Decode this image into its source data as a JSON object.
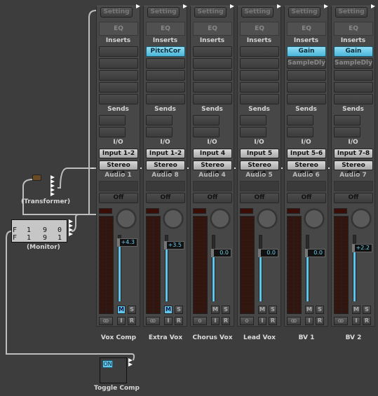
{
  "channels": [
    {
      "setting": "Setting",
      "eq": "EQ",
      "inserts_label": "Inserts",
      "inserts": [
        "",
        "",
        "",
        "",
        ""
      ],
      "sends_label": "Sends",
      "io_label": "I/O",
      "input": "Input 1-2",
      "output": "Stereo Out",
      "track": "Audio 1",
      "automation": "Off",
      "fader_db": "+4.3",
      "fader_level": 0.82,
      "mute": true,
      "solo": false,
      "stereo": true,
      "stereo_glyph": "ꝏ",
      "m": "M",
      "s": "S",
      "i": "I",
      "r": "R",
      "name": "Vox Comp"
    },
    {
      "setting": "Setting",
      "eq": "EQ",
      "inserts_label": "Inserts",
      "inserts": [
        "PitchCor",
        "",
        "",
        "",
        ""
      ],
      "sends_label": "Sends",
      "io_label": "I/O",
      "input": "Input 1-2",
      "output": "Stereo Out",
      "track": "Audio 8",
      "automation": "Off",
      "fader_db": "+3.5",
      "fader_level": 0.78,
      "mute": true,
      "solo": false,
      "stereo": true,
      "stereo_glyph": "ꝏ",
      "m": "M",
      "s": "S",
      "i": "I",
      "r": "R",
      "name": "Extra Vox"
    },
    {
      "setting": "Setting",
      "eq": "EQ",
      "inserts_label": "Inserts",
      "inserts": [
        "",
        "",
        "",
        "",
        ""
      ],
      "sends_label": "Sends",
      "io_label": "I/O",
      "input": "Input 4",
      "output": "Stereo Out",
      "track": "Audio 4",
      "automation": "Off",
      "fader_db": "0.0",
      "fader_level": 0.66,
      "mute": false,
      "solo": false,
      "stereo": false,
      "stereo_glyph": "o",
      "m": "M",
      "s": "S",
      "i": "I",
      "r": "R",
      "name": "Chorus Vox"
    },
    {
      "setting": "Setting",
      "eq": "EQ",
      "inserts_label": "Inserts",
      "inserts": [
        "",
        "",
        "",
        "",
        ""
      ],
      "sends_label": "Sends",
      "io_label": "I/O",
      "input": "Input 5",
      "output": "Stereo Out",
      "track": "Audio 5",
      "automation": "Off",
      "fader_db": "0.0",
      "fader_level": 0.66,
      "mute": false,
      "solo": false,
      "stereo": false,
      "stereo_glyph": "o",
      "m": "M",
      "s": "S",
      "i": "I",
      "r": "R",
      "name": "Lead Vox"
    },
    {
      "setting": "Setting",
      "eq": "EQ",
      "inserts_label": "Inserts",
      "inserts": [
        "Gain",
        "SampleDly",
        "",
        "",
        ""
      ],
      "sends_label": "Sends",
      "io_label": "I/O",
      "input": "Input 5-6",
      "output": "Stereo Out",
      "track": "Audio 6",
      "automation": "Off",
      "fader_db": "0.0",
      "fader_level": 0.66,
      "mute": false,
      "solo": false,
      "stereo": true,
      "stereo_glyph": "ꝏ",
      "m": "M",
      "s": "S",
      "i": "I",
      "r": "R",
      "name": "BV 1"
    },
    {
      "setting": "Setting",
      "eq": "EQ",
      "inserts_label": "Inserts",
      "inserts": [
        "Gain",
        "SampleDly",
        "",
        "",
        ""
      ],
      "sends_label": "Sends",
      "io_label": "I/O",
      "input": "Input 7-8",
      "output": "Stereo Out",
      "track": "Audio 7",
      "automation": "Off",
      "fader_db": "+2.2",
      "fader_level": 0.74,
      "mute": false,
      "solo": false,
      "stereo": true,
      "stereo_glyph": "ꝏ",
      "m": "M",
      "s": "S",
      "i": "I",
      "r": "R",
      "name": "BV 2"
    }
  ],
  "transformer": {
    "label": "(Transformer)"
  },
  "monitor": {
    "label": "(Monitor)",
    "rows": [
      [
        "F",
        "1",
        "9",
        "0"
      ],
      [
        "F",
        "1",
        "9",
        "1"
      ]
    ]
  },
  "toggle": {
    "label": "Toggle Comp",
    "button": "ON"
  },
  "colors": {
    "accent": "#5fc6ea",
    "background": "#3d3d3d"
  }
}
